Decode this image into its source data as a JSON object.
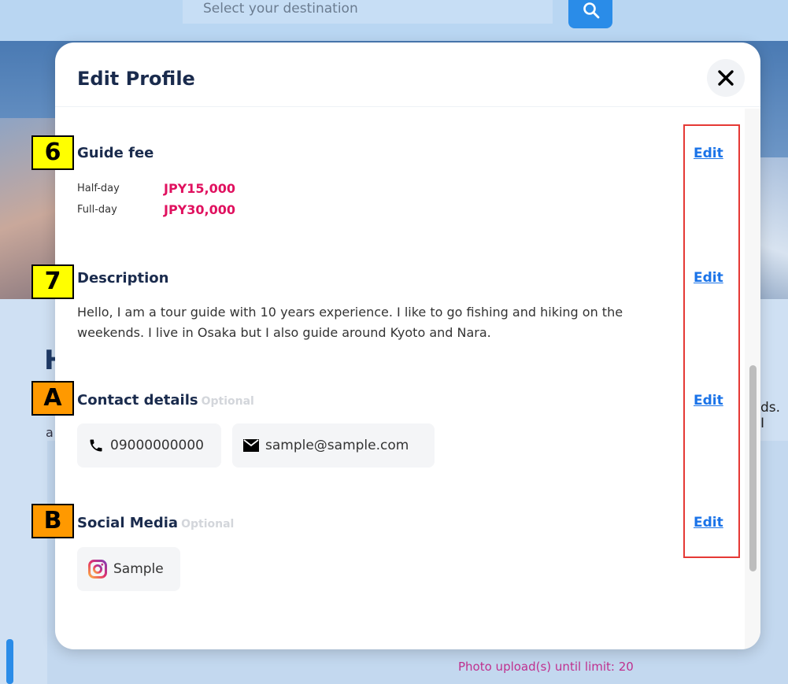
{
  "background": {
    "search_placeholder": "Select your destination",
    "heading_partial": "H",
    "line_partial": "a",
    "right_partial": "ds. I",
    "photo_limit_text": "Photo upload(s) until limit: 20"
  },
  "modal": {
    "title": "Edit Profile",
    "edit_label": "Edit",
    "optional_label": "Optional",
    "guide_fee": {
      "title": "Guide fee",
      "half_day_label": "Half-day",
      "half_day_value": "JPY15,000",
      "full_day_label": "Full-day",
      "full_day_value": "JPY30,000"
    },
    "description": {
      "title": "Description",
      "text": "Hello, I am a tour guide with 10 years experience. I like to go fishing and hiking on the weekends. I live in Osaka but I also guide around Kyoto and Nara."
    },
    "contact": {
      "title": "Contact details",
      "phone": "09000000000",
      "email": "sample@sample.com"
    },
    "social": {
      "title": "Social Media",
      "instagram": "Sample"
    }
  },
  "annotations": {
    "m6": "6",
    "m7": "7",
    "mA": "A",
    "mB": "B"
  },
  "colors": {
    "accent": "#1a73e8",
    "price": "#e0115f",
    "heading": "#1a2b4d"
  }
}
